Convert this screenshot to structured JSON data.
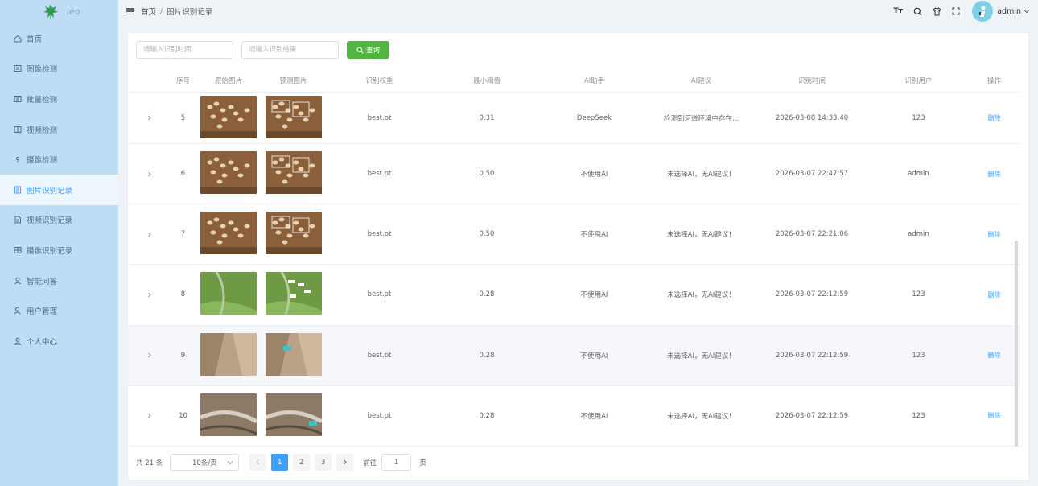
{
  "app": {
    "name": "leo"
  },
  "sidebar": {
    "items": [
      {
        "label": "首页",
        "icon": "home-icon",
        "active": false
      },
      {
        "label": "图像检测",
        "icon": "image-icon",
        "active": false
      },
      {
        "label": "批量检测",
        "icon": "batch-icon",
        "active": false
      },
      {
        "label": "视频检测",
        "icon": "video-icon",
        "active": false
      },
      {
        "label": "摄像检测",
        "icon": "camera-icon",
        "active": false
      },
      {
        "label": "图片识别记录",
        "icon": "document-icon",
        "active": true
      },
      {
        "label": "视频识别记录",
        "icon": "film-icon",
        "active": false
      },
      {
        "label": "摄像识别记录",
        "icon": "grid-icon",
        "active": false
      },
      {
        "label": "智能问答",
        "icon": "user-icon",
        "active": false
      },
      {
        "label": "用户管理",
        "icon": "users-icon",
        "active": false
      },
      {
        "label": "个人中心",
        "icon": "person-icon",
        "active": false
      }
    ]
  },
  "header": {
    "breadcrumb": [
      "首页",
      "图片识别记录"
    ],
    "icons": [
      "font-size-icon",
      "search-icon",
      "shirt-icon",
      "fullscreen-icon"
    ],
    "font_icon_text": "Tт",
    "user": "admin"
  },
  "filters": {
    "time_placeholder": "请输入识别时间",
    "result_placeholder": "请输入识别结果",
    "search_label": "查询"
  },
  "table": {
    "columns": [
      "序号",
      "原始图片",
      "预测图片",
      "识别权重",
      "最小阈值",
      "AI助手",
      "AI建议",
      "识别时间",
      "识别用户",
      "操作"
    ],
    "rows": [
      {
        "index": "5",
        "weight": "best.pt",
        "threshold": "0.31",
        "ai": "DeepSeek",
        "advice": "检测到河道环境中存在...",
        "time": "2026-03-08 14:33:40",
        "user": "123",
        "action": "删除",
        "img": "dirt"
      },
      {
        "index": "6",
        "weight": "best.pt",
        "threshold": "0.50",
        "ai": "不使用AI",
        "advice": "未选择AI，无AI建议！",
        "time": "2026-03-07 22:47:57",
        "user": "admin",
        "action": "删除",
        "img": "dirt"
      },
      {
        "index": "7",
        "weight": "best.pt",
        "threshold": "0.50",
        "ai": "不使用AI",
        "advice": "未选择AI，无AI建议！",
        "time": "2026-03-07 22:21:06",
        "user": "admin",
        "action": "删除",
        "img": "dirt"
      },
      {
        "index": "8",
        "weight": "best.pt",
        "threshold": "0.28",
        "ai": "不使用AI",
        "advice": "未选择AI，无AI建议！",
        "time": "2026-03-07 22:12:59",
        "user": "123",
        "action": "删除",
        "img": "grass"
      },
      {
        "index": "9",
        "weight": "best.pt",
        "threshold": "0.28",
        "ai": "不使用AI",
        "advice": "未选择AI，无AI建议！",
        "time": "2026-03-07 22:12:59",
        "user": "123",
        "action": "删除",
        "img": "rock"
      },
      {
        "index": "10",
        "weight": "best.pt",
        "threshold": "0.28",
        "ai": "不使用AI",
        "advice": "未选择AI，无AI建议！",
        "time": "2026-03-07 22:12:59",
        "user": "123",
        "action": "删除",
        "img": "canyon"
      }
    ],
    "highlighted_row": 4
  },
  "pagination": {
    "total_text": "共 21 条",
    "page_size": "10条/页",
    "pages": [
      "1",
      "2",
      "3"
    ],
    "current": "1",
    "goto_label": "前往",
    "goto_value": "1",
    "page_suffix": "页"
  },
  "colors": {
    "sidebar_bg": "#bfdcf5",
    "active_bg": "#eef6fd",
    "accent": "#409eff",
    "search_button": "#52b541"
  }
}
